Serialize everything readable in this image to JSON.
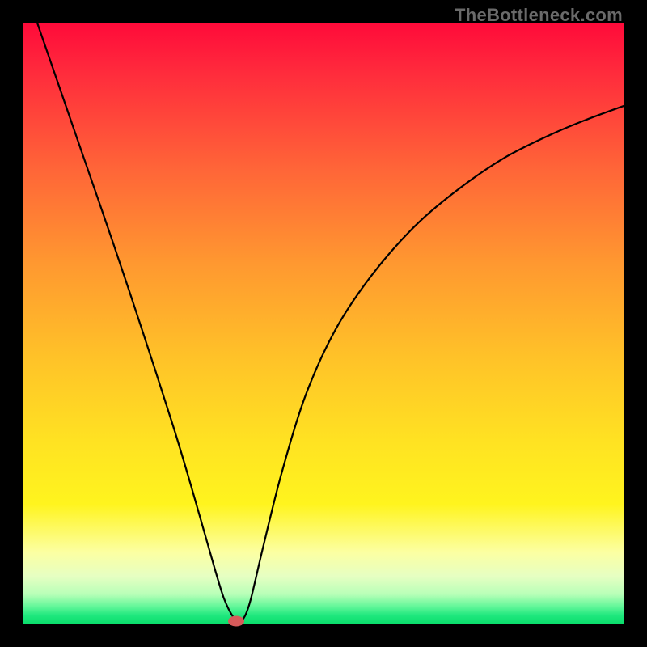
{
  "attribution": "TheBottleneck.com",
  "chart_data": {
    "type": "line",
    "title": "",
    "xlabel": "",
    "ylabel": "",
    "xlim": [
      0,
      1
    ],
    "ylim": [
      0,
      1
    ],
    "series": [
      {
        "name": "bottleneck-curve",
        "x": [
          0.0,
          0.05,
          0.1,
          0.15,
          0.2,
          0.25,
          0.28,
          0.3,
          0.32,
          0.335,
          0.35,
          0.36,
          0.37,
          0.38,
          0.4,
          0.43,
          0.47,
          0.52,
          0.58,
          0.65,
          0.72,
          0.8,
          0.88,
          0.94,
          1.0
        ],
        "y": [
          1.07,
          0.925,
          0.78,
          0.635,
          0.485,
          0.33,
          0.23,
          0.16,
          0.09,
          0.042,
          0.012,
          0.004,
          0.015,
          0.045,
          0.13,
          0.25,
          0.38,
          0.49,
          0.58,
          0.66,
          0.72,
          0.775,
          0.815,
          0.84,
          0.862
        ]
      }
    ],
    "marker": {
      "x": 0.355,
      "y": 0.006,
      "color": "#d65a5a"
    },
    "gradient_stops": [
      {
        "pos": 0.0,
        "color": "#ff0a3a"
      },
      {
        "pos": 0.8,
        "color": "#fff41e"
      },
      {
        "pos": 1.0,
        "color": "#08dd6a"
      }
    ]
  }
}
